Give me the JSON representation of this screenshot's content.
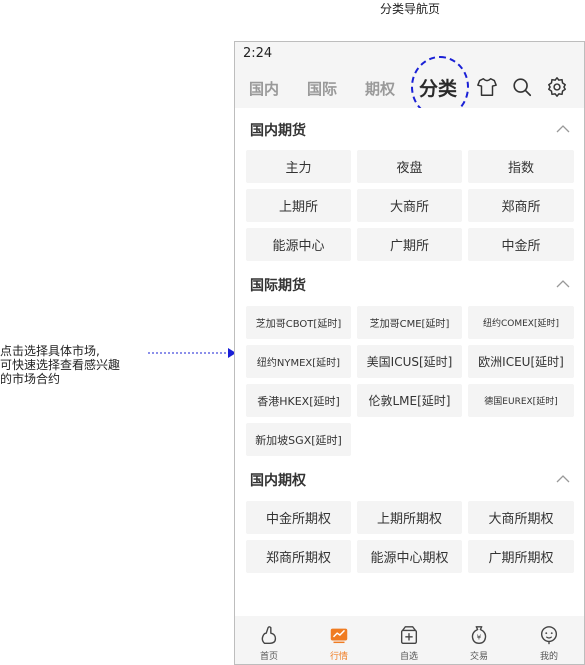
{
  "caption": "分类导航页",
  "note": {
    "line1": "点击选择具体市场,",
    "line2": "可快速选择查看感兴趣",
    "line3": "的市场合约"
  },
  "status": {
    "time": "2:24"
  },
  "topnav": {
    "tabs": [
      "国内",
      "国际",
      "期权",
      "分类"
    ],
    "active": "分类",
    "icons": [
      "shirt-icon",
      "search-icon",
      "settings-icon"
    ]
  },
  "sections": [
    {
      "title": "国内期货",
      "items": [
        "主力",
        "夜盘",
        "指数",
        "上期所",
        "大商所",
        "郑商所",
        "能源中心",
        "广期所",
        "中金所"
      ]
    },
    {
      "title": "国际期货",
      "items": [
        "芝加哥CBOT[延时]",
        "芝加哥CME[延时]",
        "纽约COMEX[延时]",
        "纽约NYMEX[延时]",
        "美国ICUS[延时]",
        "欧洲ICEU[延时]",
        "香港HKEX[延时]",
        "伦敦LME[延时]",
        "德国EUREX[延时]",
        "新加坡SGX[延时]"
      ]
    },
    {
      "title": "国内期权",
      "items": [
        "中金所期权",
        "上期所期权",
        "大商所期权",
        "郑商所期权",
        "能源中心期权",
        "广期所期权"
      ]
    }
  ],
  "tabbar": {
    "items": [
      "首页",
      "行情",
      "自选",
      "交易",
      "我的"
    ],
    "active": "行情",
    "accent": "#f07c22"
  }
}
